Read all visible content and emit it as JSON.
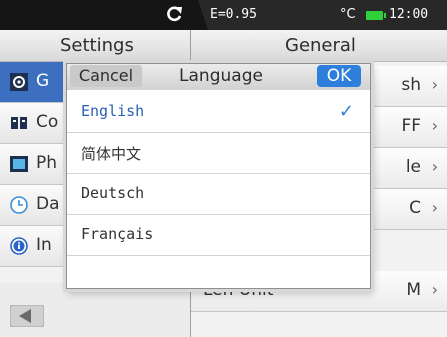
{
  "status_bar": {
    "emissivity": "E=0.95",
    "unit": "°C",
    "time": "12:00"
  },
  "header": {
    "left_title": "Settings",
    "right_title": "General"
  },
  "sidebar": {
    "items": [
      {
        "label": "G",
        "icon": "general-icon",
        "selected": true
      },
      {
        "label": "Co",
        "icon": "connection-icon",
        "selected": false
      },
      {
        "label": "Ph",
        "icon": "photo-icon",
        "selected": false
      },
      {
        "label": "Da",
        "icon": "clock-icon",
        "selected": false
      },
      {
        "label": "In",
        "icon": "info-icon",
        "selected": false
      }
    ],
    "back_icon": "back-arrow-icon"
  },
  "settings_list": {
    "rows": [
      {
        "label": "",
        "value": "sh"
      },
      {
        "label": "",
        "value": "FF"
      },
      {
        "label": "",
        "value": "le"
      },
      {
        "label": "",
        "value": "C"
      },
      {
        "label": "Len Unit",
        "value": "M"
      }
    ]
  },
  "language_dialog": {
    "cancel_label": "Cancel",
    "title": "Language",
    "ok_label": "OK",
    "options": [
      {
        "label": "English",
        "selected": true
      },
      {
        "label": "简体中文",
        "selected": false
      },
      {
        "label": "Deutsch",
        "selected": false
      },
      {
        "label": "Français",
        "selected": false
      }
    ],
    "check_mark": "✓"
  },
  "colors": {
    "selection_blue": "#3d6fc0",
    "ok_blue": "#2e7fdc",
    "battery_green": "#2ed13a"
  }
}
